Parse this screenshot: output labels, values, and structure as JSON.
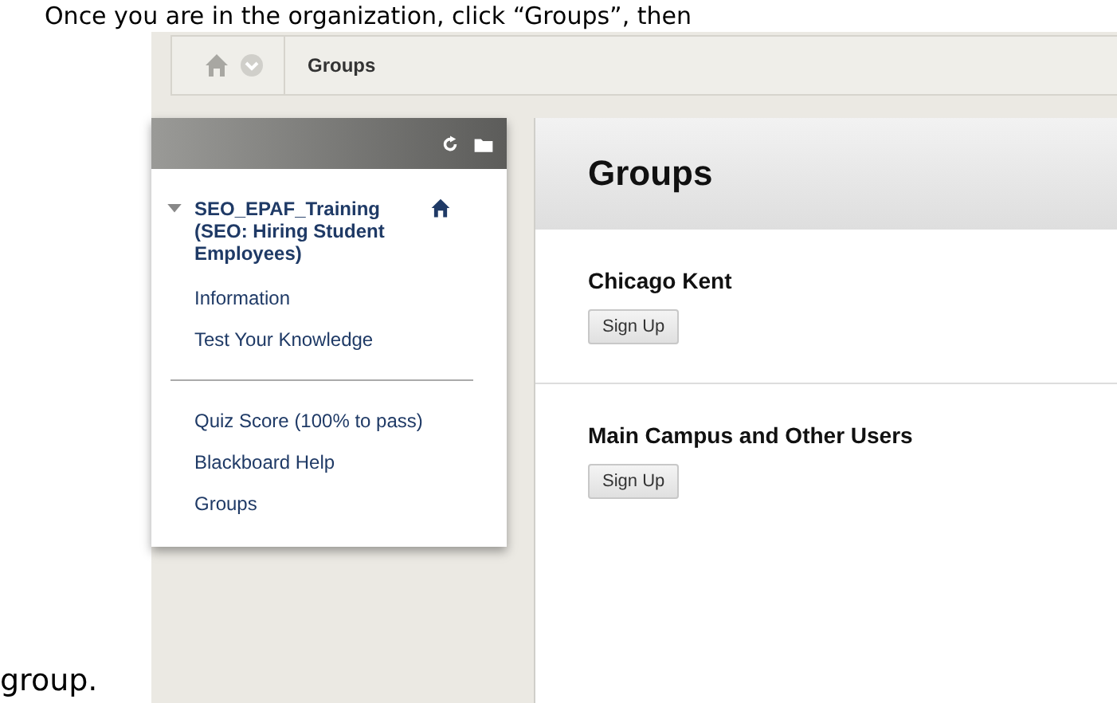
{
  "document": {
    "intro_text": "Once you are in the organization, click “Groups”, then",
    "closing_text": "group."
  },
  "breadcrumb": {
    "current": "Groups"
  },
  "course_menu": {
    "course_title": "SEO_EPAF_Training (SEO: Hiring Student Employees)",
    "expanded": true,
    "sections": [
      {
        "items": [
          "Information",
          "Test Your Knowledge"
        ]
      },
      {
        "items": [
          "Quiz Score (100% to pass)",
          "Blackboard Help",
          "Groups"
        ]
      }
    ]
  },
  "content": {
    "title": "Groups",
    "groups": [
      {
        "name": "Chicago Kent",
        "button": "Sign Up"
      },
      {
        "name": "Main Campus and Other Users",
        "button": "Sign Up"
      }
    ]
  }
}
